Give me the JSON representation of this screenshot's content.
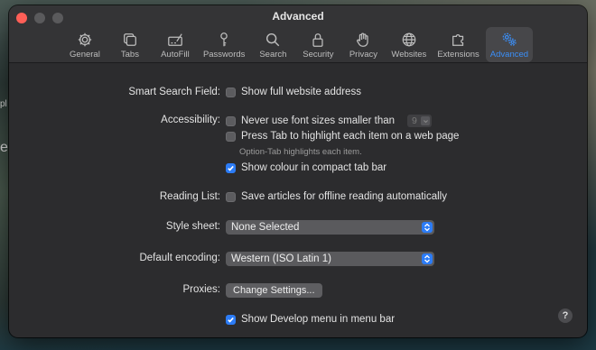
{
  "window": {
    "title": "Advanced"
  },
  "toolbar": {
    "items": [
      {
        "label": "General",
        "icon": "gear-icon"
      },
      {
        "label": "Tabs",
        "icon": "tabs-icon"
      },
      {
        "label": "AutoFill",
        "icon": "autofill-icon"
      },
      {
        "label": "Passwords",
        "icon": "key-icon"
      },
      {
        "label": "Search",
        "icon": "search-icon"
      },
      {
        "label": "Security",
        "icon": "lock-icon"
      },
      {
        "label": "Privacy",
        "icon": "hand-icon"
      },
      {
        "label": "Websites",
        "icon": "globe-icon"
      },
      {
        "label": "Extensions",
        "icon": "extensions-icon"
      },
      {
        "label": "Advanced",
        "icon": "gears-icon",
        "active": true
      }
    ],
    "accent": "#3b8ff8"
  },
  "settings": {
    "smart_search": {
      "label": "Smart Search Field:",
      "option": "Show full website address",
      "checked": false
    },
    "accessibility": {
      "label": "Accessibility:",
      "font_option": "Never use font sizes smaller than",
      "font_size": "9",
      "tab_option": "Press Tab to highlight each item on a web page",
      "tab_hint": "Option-Tab highlights each item.",
      "colour_option": "Show colour in compact tab bar",
      "colour_checked": true
    },
    "reading_list": {
      "label": "Reading List:",
      "option": "Save articles for offline reading automatically",
      "checked": false
    },
    "style_sheet": {
      "label": "Style sheet:",
      "value": "None Selected"
    },
    "encoding": {
      "label": "Default encoding:",
      "value": "Western (ISO Latin 1)"
    },
    "proxies": {
      "label": "Proxies:",
      "button": "Change Settings..."
    },
    "develop": {
      "option": "Show Develop menu in menu bar",
      "checked": true
    }
  },
  "help": {
    "label": "?"
  },
  "desktop": {
    "fragment_1": "pl",
    "fragment_2": "e"
  }
}
